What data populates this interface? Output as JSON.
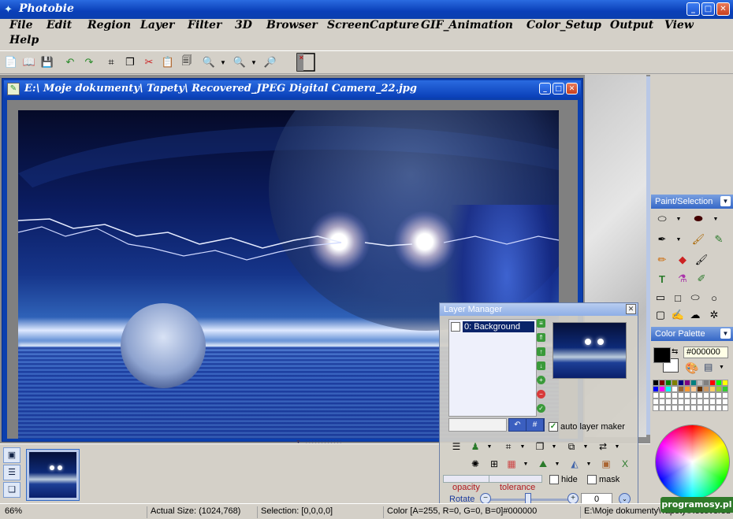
{
  "app": {
    "title": "Photobie"
  },
  "menu": [
    "File",
    "Edit",
    "Region",
    "Layer",
    "Filter",
    "3D",
    "Browser",
    "ScreenCapture",
    "GIF_Animation",
    "Color_Setup",
    "Output",
    "View",
    "Help"
  ],
  "toolbar": {
    "icons": [
      "new-icon",
      "open-icon",
      "save-icon",
      "undo-icon",
      "redo-icon",
      "crop-icon",
      "copy-icon",
      "cut-icon",
      "paste-icon",
      "paste-new-icon",
      "zoom-in-icon",
      "zoom-out-icon",
      "zoom-fit-icon",
      "scissors-icon"
    ]
  },
  "document": {
    "title": "E:\\ Moje dokumenty\\ Tapety\\ Recovered_JPEG Digital Camera_22.jpg"
  },
  "panels": {
    "paint_selection": "Paint/Selection",
    "color_palette": "Color Palette",
    "hex_value": "#000000",
    "palette_colors": [
      "#000000",
      "#800000",
      "#008000",
      "#808000",
      "#000080",
      "#800080",
      "#008080",
      "#c0c0c0",
      "#808080",
      "#ff0000",
      "#00ff00",
      "#ffff00",
      "#0000ff",
      "#ff00ff",
      "#00ffff",
      "#ffffff",
      "#996633",
      "#ff9933",
      "#ffcc99",
      "#663300",
      "#cc9966",
      "#ffcc66",
      "#99cc33",
      "#33cc33",
      "#ffffff",
      "#ffffff",
      "#ffffff",
      "#ffffff",
      "#ffffff",
      "#ffffff",
      "#ffffff",
      "#ffffff",
      "#ffffff",
      "#ffffff",
      "#ffffff",
      "#ffffff",
      "#ffffff",
      "#ffffff",
      "#ffffff",
      "#ffffff",
      "#ffffff",
      "#ffffff",
      "#ffffff",
      "#ffffff",
      "#ffffff",
      "#ffffff",
      "#ffffff",
      "#ffffff",
      "#ffffff",
      "#ffffff",
      "#ffffff",
      "#ffffff",
      "#ffffff",
      "#ffffff",
      "#ffffff",
      "#ffffff",
      "#ffffff",
      "#ffffff",
      "#ffffff",
      "#ffffff"
    ]
  },
  "layer_manager": {
    "title": "Layer Manager",
    "layers": [
      {
        "name": "0: Background"
      }
    ],
    "auto_layer_maker": "auto layer maker",
    "opacity_label": "opacity",
    "tolerance_label": "tolerance",
    "hide_label": "hide",
    "mask_label": "mask",
    "rotate_label": "Rotate",
    "rotate_value": "0"
  },
  "status": {
    "zoom": "66%",
    "actual_size": "Actual Size: (1024,768)",
    "selection": "Selection: [0,0,0,0]",
    "color": "Color [A=255, R=0, G=0, B=0]#000000",
    "path": "E:\\Moje dokumenty\\Tapety\\Recovered"
  },
  "watermark": "programosy.pl"
}
